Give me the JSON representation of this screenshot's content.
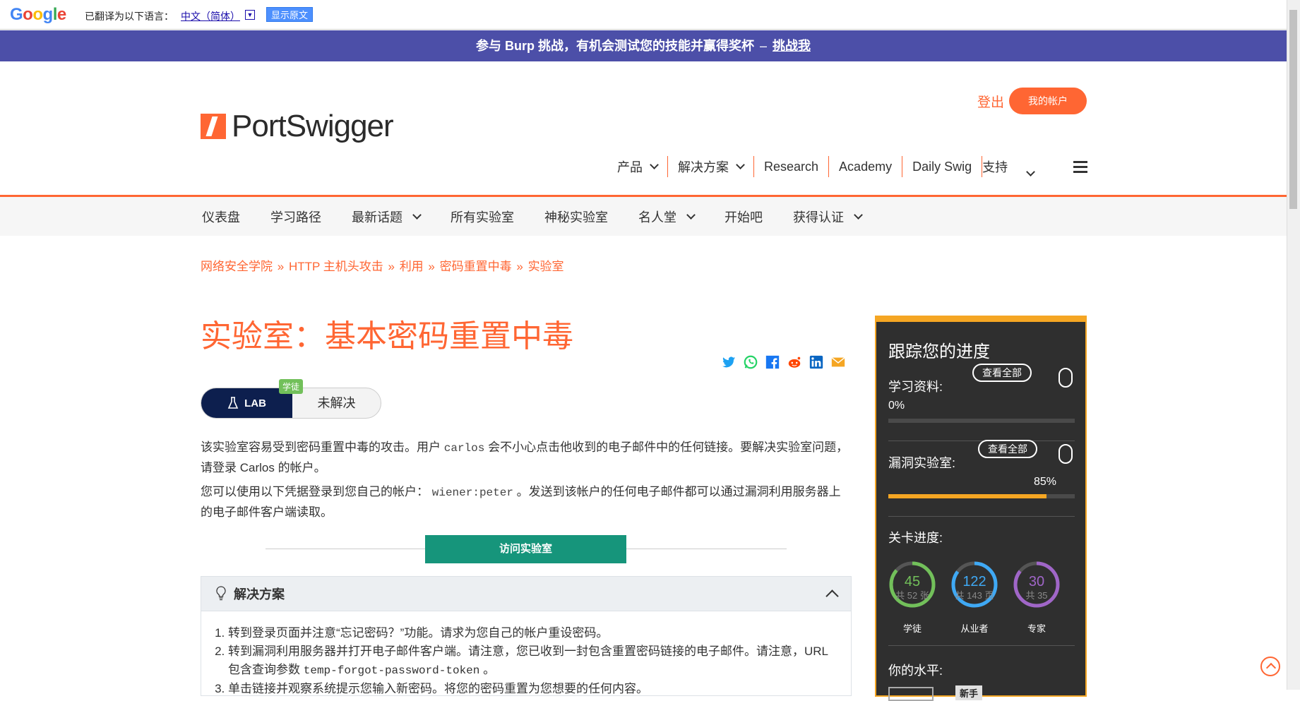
{
  "translate_bar": {
    "logo": [
      "G",
      "o",
      "o",
      "g",
      "l",
      "e"
    ],
    "label": "已翻译为以下语言：",
    "language": "中文（简体）",
    "dropdown_glyph": "▼",
    "show_original": "显示原文"
  },
  "promo": {
    "text": "参与 Burp 挑战，有机会测试您的技能并赢得奖杯",
    "dash": "–",
    "link": "挑战我"
  },
  "header": {
    "logo_text": "PortSwigger",
    "login": "登出",
    "account": "我的帐户",
    "nav": [
      {
        "label": "产品"
      },
      {
        "label": "解决方案"
      },
      {
        "label": "Research"
      },
      {
        "label": "Academy"
      },
      {
        "label": "Daily Swig"
      },
      {
        "label": "支持"
      }
    ]
  },
  "subnav": [
    "仪表盘",
    "学习路径",
    "最新话题",
    "所有实验室",
    "神秘实验室",
    "名人堂",
    "开始吧",
    "获得认证"
  ],
  "breadcrumb": [
    "网络安全学院",
    "HTTP 主机头攻击",
    "利用",
    "密码重置中毒",
    "实验室"
  ],
  "breadcrumb_sep": "»",
  "page": {
    "title": "实验室：基本密码重置中毒",
    "lab_label": "LAB",
    "lab_status": "未解决",
    "level_badge": "学徒",
    "desc1_a": "该实验室容易受到密码重置中毒的攻击。用户 ",
    "desc1_code": "carlos",
    "desc1_b": " 会不小心点击他收到的电子邮件中的任何链接。要解决实验室问题，请登录 Carlos 的帐户。",
    "desc2_a": "您可以使用以下凭据登录到您自己的帐户： ",
    "desc2_code": "wiener:peter",
    "desc2_b": " 。发送到该帐户的任何电子邮件都可以通过漏洞利用服务器上的电子邮件客户端读取。",
    "access_button": "访问实验室",
    "solution_title": "解决方案",
    "steps": {
      "s1": "转到登录页面并注意“忘记密码？”功能。请求为您自己的帐户重设密码。",
      "s2_a": "转到漏洞利用服务器并打开电子邮件客户端。请注意，您已收到一封包含重置密码链接的电子邮件。请注意，URL 包含查询参数 ",
      "s2_code": "temp-forgot-password-token",
      "s2_b": " 。",
      "s3": "单击链接并观察系统提示您输入新密码。将您的密码重置为您想要的任何内容。"
    }
  },
  "sidebar": {
    "title": "跟踪您的进度",
    "learning_label": "学习资料:",
    "learning_pct": "0%",
    "learning_fill": 0.0,
    "view_all": "查看全部",
    "vuln_label": "漏洞实验室:",
    "vuln_pct": "85%",
    "vuln_fill": 0.85,
    "levels_label": "关卡进度:",
    "rings": [
      {
        "value": "45",
        "total": "共 52 张",
        "label": "学徒",
        "color": "#72c05a",
        "fraction": 0.865
      },
      {
        "value": "122",
        "total": "共 143 页",
        "label": "从业者",
        "color": "#3fa9f5",
        "fraction": 0.853
      },
      {
        "value": "30",
        "total": "共 35",
        "label": "专家",
        "color": "#a066c8",
        "fraction": 0.857
      }
    ],
    "your_level": "你的水平:",
    "level_name": "新手"
  },
  "colors": {
    "brand": "#ff6633",
    "promo": "#4c4fa8",
    "access": "#16957b",
    "sidebar_accent": "#f5a623"
  }
}
